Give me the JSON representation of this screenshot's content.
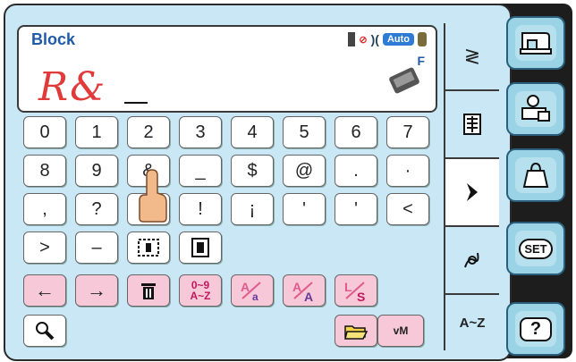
{
  "display": {
    "mode_title": "Block",
    "input_text": "R&",
    "foot_letter": "F",
    "status_auto": "Auto"
  },
  "keys": {
    "row1": [
      "0",
      "1",
      "2",
      "3",
      "4",
      "5",
      "6",
      "7"
    ],
    "row2": [
      "8",
      "9",
      "&",
      "_",
      "$",
      "@",
      ".",
      "·"
    ],
    "row3": [
      ",",
      "?",
      "",
      "!",
      "¡",
      "'",
      "'",
      "<"
    ],
    "row4": [
      ">",
      "–",
      "",
      ""
    ],
    "row5": [
      "←",
      "→",
      "",
      "0~9\nA~Z",
      "",
      "",
      "",
      ""
    ],
    "row6": [
      "",
      "vM"
    ]
  },
  "tabs": {
    "tab1": "≷",
    "tab4_label": "",
    "az_label": "A~Z"
  },
  "side": {
    "set_label": "SET",
    "help_label": "?"
  },
  "colors": {
    "screen_bg": "#c9e7f4",
    "display_text_red": "#e03a3a",
    "mode_title_blue": "#1f5aa8",
    "pink_key": "#f6c8d8"
  }
}
